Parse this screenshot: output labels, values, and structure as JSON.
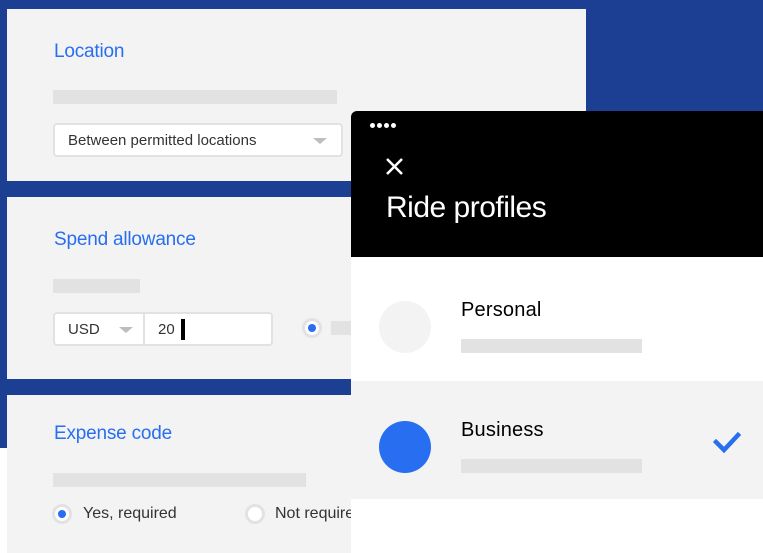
{
  "location": {
    "title": "Location",
    "select_value": "Between permitted locations"
  },
  "spend": {
    "title": "Spend allowance",
    "currency": "USD",
    "amount": "20"
  },
  "expense": {
    "title": "Expense code",
    "option_required": "Yes, required",
    "option_not_required": "Not require"
  },
  "phone": {
    "title": "Ride profiles",
    "profiles": [
      {
        "name": "Personal",
        "selected": false,
        "avatar_color": "#f3f3f3"
      },
      {
        "name": "Business",
        "selected": true,
        "avatar_color": "#276ef1"
      }
    ]
  },
  "colors": {
    "background_blue": "#1c3f94",
    "accent_blue": "#276ef1",
    "header_black": "#000000"
  },
  "icons": {
    "close": "close-icon",
    "check": "check-icon",
    "caret": "chevron-down-icon"
  }
}
